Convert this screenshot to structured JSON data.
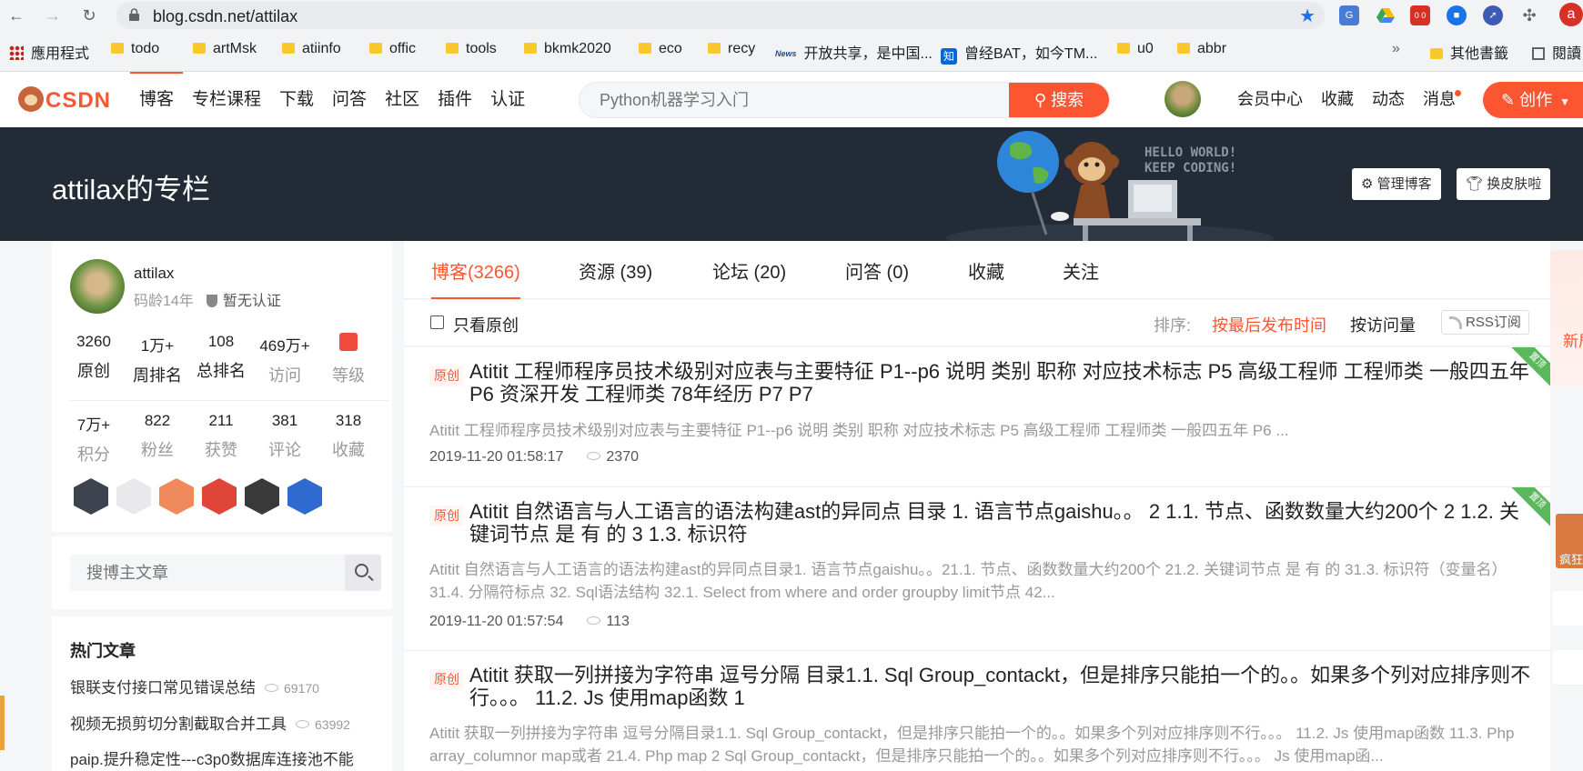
{
  "browser": {
    "url": "blog.csdn.net/attilax",
    "bookmarks": [
      {
        "label": "應用程式",
        "kind": "apps"
      },
      {
        "label": "todo",
        "kind": "folder"
      },
      {
        "label": "artMsk",
        "kind": "folder"
      },
      {
        "label": "atiinfo",
        "kind": "folder"
      },
      {
        "label": "offic",
        "kind": "folder"
      },
      {
        "label": "tools",
        "kind": "folder"
      },
      {
        "label": "bkmk2020",
        "kind": "folder"
      },
      {
        "label": "eco",
        "kind": "folder"
      },
      {
        "label": "recy",
        "kind": "folder"
      },
      {
        "label": "开放共享，是中国...",
        "kind": "news"
      },
      {
        "label": "曾经BAT，如今TM...",
        "kind": "zhihu"
      },
      {
        "label": "u0",
        "kind": "folder"
      },
      {
        "label": "abbr",
        "kind": "folder"
      }
    ],
    "more_label": "»",
    "other_bookmarks": "其他書籤",
    "reading_list": "閱讀",
    "profile_letter": "a",
    "ext_badge": "0 0"
  },
  "toolbar": {
    "logo": "CSDN",
    "nav": [
      "博客",
      "专栏课程",
      "下载",
      "问答",
      "社区",
      "插件",
      "认证"
    ],
    "search_placeholder": "Python机器学习入门",
    "search_button": "搜索",
    "right_nav": [
      "会员中心",
      "收藏",
      "动态",
      "消息"
    ],
    "create_button": "创作"
  },
  "banner": {
    "title": "attilax的专栏",
    "hello_line1": "HELLO WORLD!",
    "hello_line2": "KEEP CODING!",
    "manage_button": "管理博客",
    "skin_button": "换皮肤啦"
  },
  "profile": {
    "name": "attilax",
    "age": "码龄14年",
    "cert": "暂无认证",
    "stats_row1": [
      {
        "value": "3260",
        "label": "原创"
      },
      {
        "value": "1万+",
        "label": "周排名"
      },
      {
        "value": "108",
        "label": "总排名"
      },
      {
        "value": "469万+",
        "label": "访问"
      },
      {
        "value": "",
        "label": "等级"
      }
    ],
    "stats_row2": [
      {
        "value": "7万+",
        "label": "积分"
      },
      {
        "value": "822",
        "label": "粉丝"
      },
      {
        "value": "211",
        "label": "获赞"
      },
      {
        "value": "381",
        "label": "评论"
      },
      {
        "value": "318",
        "label": "收藏"
      }
    ],
    "badges": [
      "#3d4450",
      "#e9e9ec",
      "#f08a5d",
      "#e0453a",
      "#3a3a3a",
      "#2f6ad1"
    ]
  },
  "blog_search": {
    "placeholder": "搜博主文章"
  },
  "hot": {
    "title": "热门文章",
    "items": [
      {
        "title": "银联支付接口常见错误总结",
        "views": "69170"
      },
      {
        "title": "视频无损剪切分割截取合并工具",
        "views": "63992"
      },
      {
        "title": "paip.提升稳定性---c3p0数据库连接池不能",
        "views": ""
      }
    ]
  },
  "tabs": [
    "博客(3266)",
    "资源 (39)",
    "论坛 (20)",
    "问答 (0)",
    "收藏",
    "关注"
  ],
  "filter": {
    "only_original": "只看原创",
    "sort_label": "排序:",
    "sort_latest": "按最后发布时间",
    "sort_views": "按访问量",
    "rss": "RSS订阅"
  },
  "articles": [
    {
      "tag": "原创",
      "title": "Atitit 工程师程序员技术级别对应表与主要特征 P1--p6 说明 类别 职称 对应技术标志 P5 高级工程师 工程师类 一般四五年 P6 资深开发 工程师类 78年经历 P7 P7",
      "desc": "Atitit 工程师程序员技术级别对应表与主要特征 P1--p6 说明 类别 职称 对应技术标志 P5 高级工程师 工程师类 一般四五年 P6 ...",
      "date": "2019-11-20 01:58:17",
      "views": "2370",
      "corner": "置顶"
    },
    {
      "tag": "原创",
      "title": "Atitit 自然语言与人工语言的语法构建ast的异同点 目录 1. 语言节点gaishu。。 2 1.1. 节点、函数数量大约200个 2 1.2. 关键词节点 是 有 的 3 1.3. 标识符",
      "desc": "Atitit 自然语言与人工语言的语法构建ast的异同点目录1. 语言节点gaishu。。21.1. 节点、函数数量大约200个 21.2. 关键词节点 是 有 的 31.3. 标识符（变量名） 31.4. 分隔符标点 32. Sql语法结构 32.1. Select from where and order groupby limit节点 42...",
      "date": "2019-11-20 01:57:54",
      "views": "113",
      "corner": "置顶"
    },
    {
      "tag": "原创",
      "title": "Atitit 获取一列拼接为字符串 逗号分隔 目录1.1. Sql Group_contackt，但是排序只能拍一个的。。如果多个列对应排序则不行。。。 11.2. Js 使用map函数 1",
      "desc": "Atitit 获取一列拼接为字符串 逗号分隔目录1.1. Sql Group_contackt，但是排序只能拍一个的。。如果多个列对应排序则不行。。。 11.2. Js 使用map函数 11.3. Php array_columnor map或者 21.4. Php map 2 Sql Group_contackt，但是排序只能拍一个的。。如果多个列对应排序则不行。。。 Js 使用map函..."
    }
  ],
  "edge": {
    "ad_text": "新居 主页",
    "gift_text": "疯狂"
  }
}
